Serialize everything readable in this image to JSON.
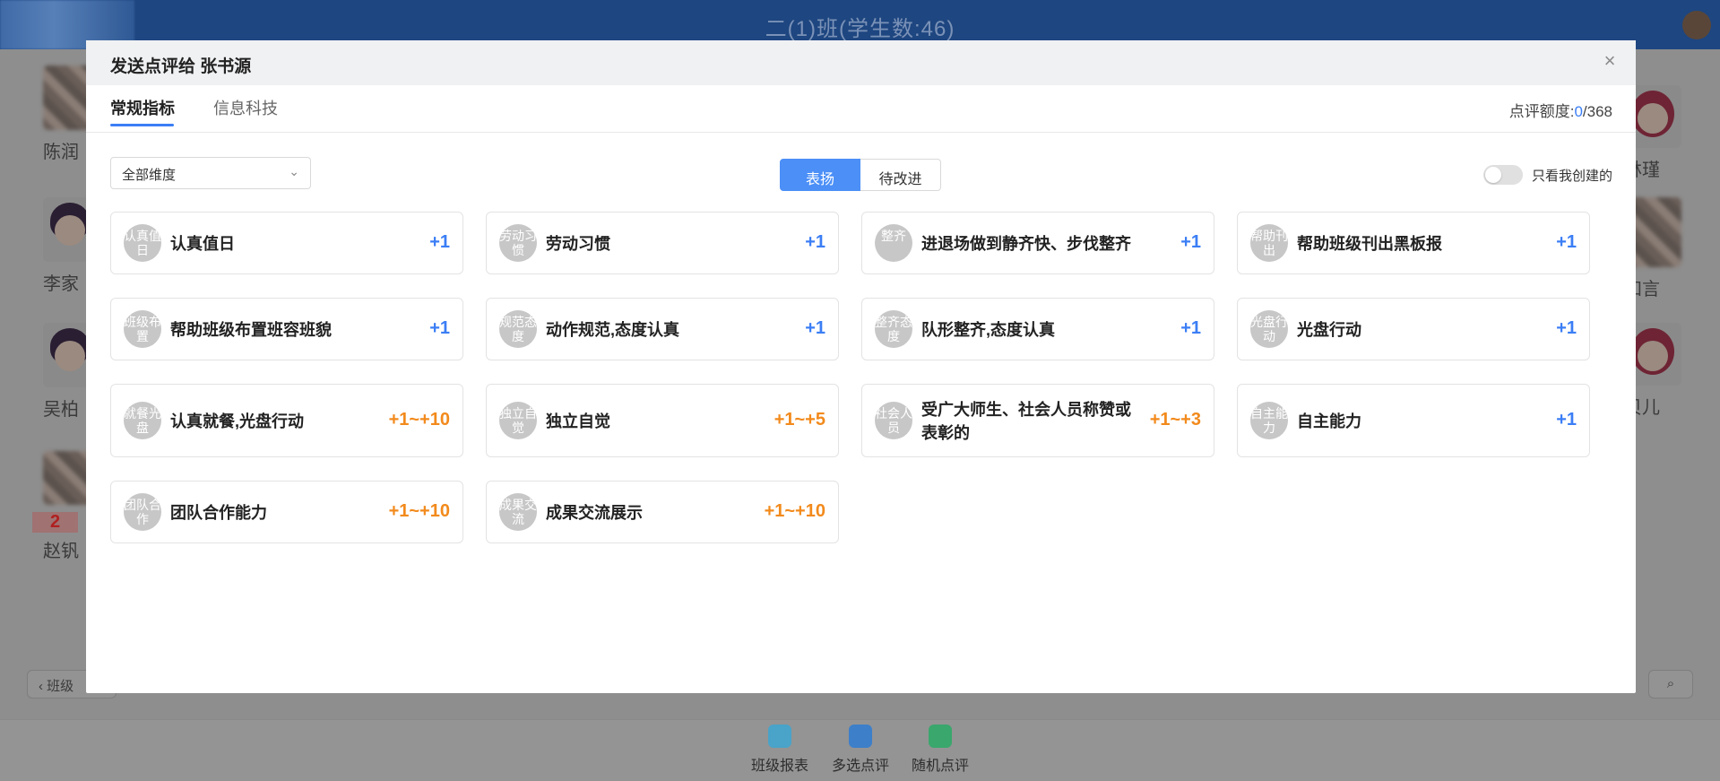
{
  "background": {
    "page_title": "二(1)班(学生数:46)",
    "students_left": [
      "陈润",
      "李家",
      "吴柏",
      "赵钒"
    ],
    "students_right": [
      "林瑾",
      "知言",
      "贝儿"
    ],
    "badge_count": "2",
    "left_button_label": "班级",
    "footer": [
      {
        "label": "班级报表",
        "icon": "report-icon",
        "color": "#4aa3c8"
      },
      {
        "label": "多选点评",
        "icon": "edit-icon",
        "color": "#3d7fc9"
      },
      {
        "label": "随机点评",
        "icon": "random-icon",
        "color": "#3aa76d"
      }
    ]
  },
  "modal": {
    "title": "发送点评给 张书源",
    "close_icon": "×",
    "tabs": [
      {
        "label": "常规指标",
        "active": true
      },
      {
        "label": "信息科技",
        "active": false
      }
    ],
    "quota": {
      "label": "点评额度:",
      "used": "0",
      "total": "/368"
    },
    "dimension_select": {
      "value": "全部维度",
      "arrow": "⌄"
    },
    "segments": {
      "praise": "表扬",
      "improve": "待改进"
    },
    "toggle_label": "只看我创建的",
    "cards": [
      {
        "icon_text": "认真值日",
        "name": "认真值日",
        "points": "+1",
        "color": "blue"
      },
      {
        "icon_text": "劳动习惯",
        "name": "劳动习惯",
        "points": "+1",
        "color": "blue"
      },
      {
        "icon_text": "整齐",
        "name": "进退场做到静齐快、步伐整齐",
        "points": "+1",
        "color": "blue"
      },
      {
        "icon_text": "帮助刊出",
        "name": "帮助班级刊出黑板报",
        "points": "+1",
        "color": "blue"
      },
      {
        "icon_text": "班级布置",
        "name": "帮助班级布置班容班貌",
        "points": "+1",
        "color": "blue"
      },
      {
        "icon_text": "规范态度",
        "name": "动作规范,态度认真",
        "points": "+1",
        "color": "blue"
      },
      {
        "icon_text": "整齐态度",
        "name": "队形整齐,态度认真",
        "points": "+1",
        "color": "blue"
      },
      {
        "icon_text": "光盘行动",
        "name": "光盘行动",
        "points": "+1",
        "color": "blue"
      },
      {
        "icon_text": "就餐光盘",
        "name": "认真就餐,光盘行动",
        "points": "+1~+10",
        "color": "orange"
      },
      {
        "icon_text": "独立自觉",
        "name": "独立自觉",
        "points": "+1~+5",
        "color": "orange"
      },
      {
        "icon_text": "社会人员",
        "name": "受广大师生、社会人员称赞或表彰的",
        "points": "+1~+3",
        "color": "orange"
      },
      {
        "icon_text": "自主能力",
        "name": "自主能力",
        "points": "+1",
        "color": "blue"
      },
      {
        "icon_text": "团队合作",
        "name": "团队合作能力",
        "points": "+1~+10",
        "color": "orange"
      },
      {
        "icon_text": "成果交流",
        "name": "成果交流展示",
        "points": "+1~+10",
        "color": "orange"
      }
    ]
  }
}
